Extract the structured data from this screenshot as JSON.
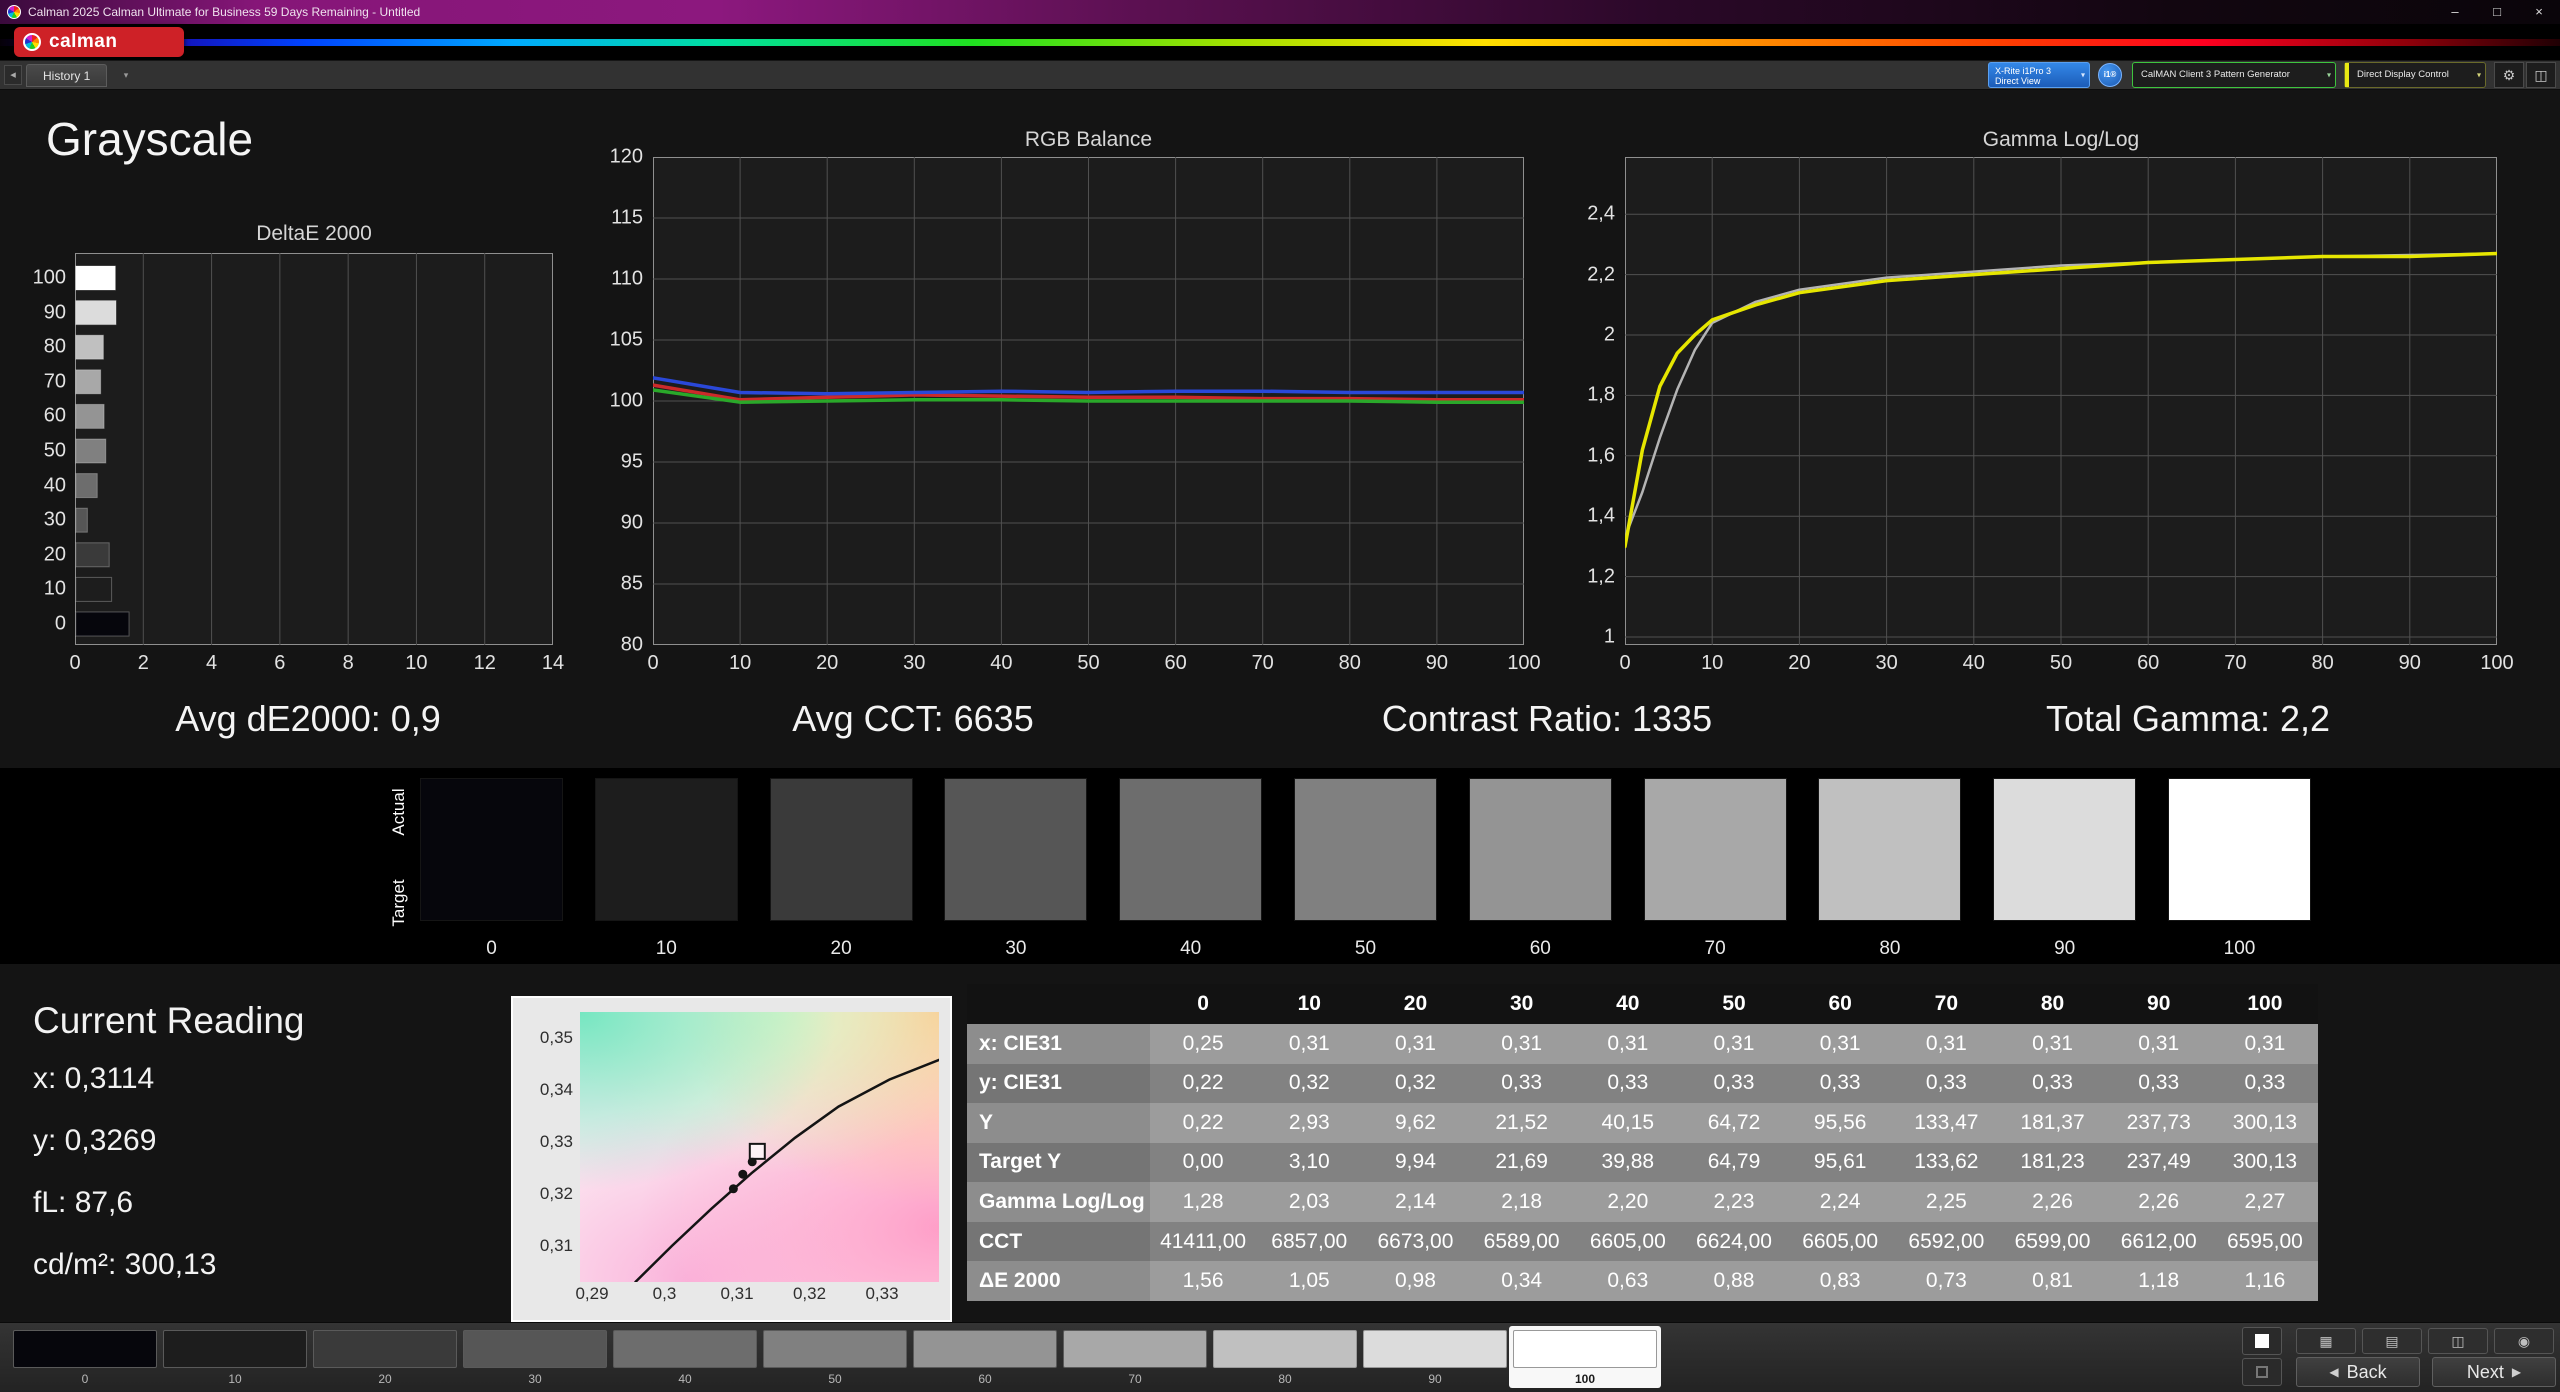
{
  "window": {
    "title": "Calman 2025 Calman Ultimate for Business 59 Days Remaining  - Untitled",
    "minimize": "–",
    "maximize": "□",
    "close": "×"
  },
  "logo": {
    "text": "calman"
  },
  "toolbar": {
    "history_tab": "History 1",
    "tab_scroll_icon": "◂",
    "tab_menu_icon": "▾",
    "chevron": "▾",
    "meter_line1": "X-Rite i1Pro 3",
    "meter_line2": "Direct View",
    "meter_badge": "i1®",
    "source": "CalMAN Client 3 Pattern Generator",
    "control": "Direct Display Control",
    "gear_icon": "⚙",
    "panel_icon": "◫"
  },
  "page": {
    "title": "Grayscale"
  },
  "charts": {
    "deltae": {
      "title": "DeltaE 2000",
      "y_ticks": [
        "100",
        "90",
        "80",
        "70",
        "60",
        "50",
        "40",
        "30",
        "20",
        "10",
        "0"
      ],
      "x_ticks": [
        "0",
        "2",
        "4",
        "6",
        "8",
        "10",
        "12",
        "14"
      ],
      "x_max": 14,
      "bars": [
        {
          "level": "100",
          "value": 1.16
        },
        {
          "level": "90",
          "value": 1.18
        },
        {
          "level": "80",
          "value": 0.81
        },
        {
          "level": "70",
          "value": 0.73
        },
        {
          "level": "60",
          "value": 0.83
        },
        {
          "level": "50",
          "value": 0.88
        },
        {
          "level": "40",
          "value": 0.63
        },
        {
          "level": "30",
          "value": 0.34
        },
        {
          "level": "20",
          "value": 0.98
        },
        {
          "level": "10",
          "value": 1.05
        },
        {
          "level": "0",
          "value": 1.56
        }
      ]
    },
    "rgb": {
      "title": "RGB Balance",
      "y_ticks": [
        "120",
        "115",
        "110",
        "105",
        "100",
        "95",
        "90",
        "85",
        "80"
      ],
      "x_ticks": [
        "0",
        "10",
        "20",
        "30",
        "40",
        "50",
        "60",
        "70",
        "80",
        "90",
        "100"
      ],
      "series": [
        {
          "name": "red",
          "color": "#cc2a2a",
          "values": [
            101.3,
            100.1,
            100.3,
            100.5,
            100.4,
            100.3,
            100.3,
            100.2,
            100.2,
            100.1,
            100.1
          ]
        },
        {
          "name": "green",
          "color": "#2aa82a",
          "values": [
            100.9,
            99.9,
            100.0,
            100.1,
            100.1,
            100.0,
            100.0,
            100.0,
            100.0,
            99.9,
            99.9
          ]
        },
        {
          "name": "blue",
          "color": "#2a48d8",
          "values": [
            101.9,
            100.7,
            100.6,
            100.7,
            100.8,
            100.7,
            100.8,
            100.8,
            100.7,
            100.7,
            100.7
          ]
        }
      ]
    },
    "gamma": {
      "title": "Gamma Log/Log",
      "y_ticks": [
        "2,4",
        "2,2",
        "2",
        "1,8",
        "1,6",
        "1,4",
        "1,2",
        "1"
      ],
      "x_ticks": [
        "0",
        "10",
        "20",
        "30",
        "40",
        "50",
        "60",
        "70",
        "80",
        "90",
        "100"
      ],
      "series": [
        {
          "name": "target",
          "color": "#b4b4b4",
          "width": 2.5,
          "x": [
            0,
            2,
            4,
            6,
            8,
            10,
            15,
            20,
            30,
            40,
            50,
            60,
            70,
            80,
            90,
            100
          ],
          "y": [
            1.33,
            1.48,
            1.66,
            1.82,
            1.95,
            2.04,
            2.11,
            2.15,
            2.19,
            2.21,
            2.23,
            2.24,
            2.25,
            2.26,
            2.265,
            2.27
          ]
        },
        {
          "name": "measured",
          "color": "#e6e600",
          "width": 3.5,
          "x": [
            0,
            2,
            4,
            6,
            8,
            10,
            15,
            20,
            30,
            40,
            50,
            60,
            70,
            80,
            90,
            100
          ],
          "y": [
            1.3,
            1.62,
            1.83,
            1.94,
            2.0,
            2.05,
            2.1,
            2.14,
            2.18,
            2.2,
            2.22,
            2.24,
            2.25,
            2.26,
            2.26,
            2.27
          ]
        }
      ]
    }
  },
  "stats": [
    "Avg dE2000: 0,9",
    "Avg CCT: 6635",
    "Contrast Ratio: 1335",
    "Total Gamma: 2,2"
  ],
  "swatches": {
    "row_labels": [
      "Actual",
      "Target"
    ],
    "levels": [
      "0",
      "10",
      "20",
      "30",
      "40",
      "50",
      "60",
      "70",
      "80",
      "90",
      "100"
    ],
    "colors": [
      "#06060c",
      "#1d1d1d",
      "#3a3a3a",
      "#565656",
      "#6d6d6d",
      "#808080",
      "#949494",
      "#a8a8a8",
      "#c0c0c0",
      "#dcdcdc",
      "#ffffff"
    ]
  },
  "reading": {
    "title": "Current Reading",
    "lines": [
      "x: 0,3114",
      "y: 0,3269",
      "fL: 87,6",
      "cd/m²: 300,13"
    ]
  },
  "cie": {
    "y_ticks": [
      "0,35",
      "0,34",
      "0,33",
      "0,32",
      "0,31"
    ],
    "x_ticks": [
      "0,29",
      "0,3",
      "0,31",
      "0,32",
      "0,33"
    ],
    "curve": [
      [
        0.296,
        0.3031
      ],
      [
        0.301,
        0.31
      ],
      [
        0.3065,
        0.3172
      ],
      [
        0.312,
        0.324
      ],
      [
        0.318,
        0.3308
      ],
      [
        0.324,
        0.3368
      ],
      [
        0.331,
        0.342
      ],
      [
        0.3379,
        0.3458
      ]
    ],
    "points": [
      [
        0.3095,
        0.321
      ],
      [
        0.3108,
        0.3238
      ],
      [
        0.3121,
        0.3262
      ]
    ],
    "marker": [
      0.3128,
      0.3282
    ]
  },
  "table": {
    "columns": [
      "0",
      "10",
      "20",
      "30",
      "40",
      "50",
      "60",
      "70",
      "80",
      "90",
      "100"
    ],
    "rows": [
      {
        "label": "x: CIE31",
        "values": [
          "0,25",
          "0,31",
          "0,31",
          "0,31",
          "0,31",
          "0,31",
          "0,31",
          "0,31",
          "0,31",
          "0,31",
          "0,31"
        ]
      },
      {
        "label": "y: CIE31",
        "values": [
          "0,22",
          "0,32",
          "0,32",
          "0,33",
          "0,33",
          "0,33",
          "0,33",
          "0,33",
          "0,33",
          "0,33",
          "0,33"
        ]
      },
      {
        "label": "Y",
        "values": [
          "0,22",
          "2,93",
          "9,62",
          "21,52",
          "40,15",
          "64,72",
          "95,56",
          "133,47",
          "181,37",
          "237,73",
          "300,13"
        ]
      },
      {
        "label": "Target Y",
        "values": [
          "0,00",
          "3,10",
          "9,94",
          "21,69",
          "39,88",
          "64,79",
          "95,61",
          "133,62",
          "181,23",
          "237,49",
          "300,13"
        ]
      },
      {
        "label": "Gamma Log/Log",
        "values": [
          "1,28",
          "2,03",
          "2,14",
          "2,18",
          "2,20",
          "2,23",
          "2,24",
          "2,25",
          "2,26",
          "2,26",
          "2,27"
        ]
      },
      {
        "label": "CCT",
        "values": [
          "41411,00",
          "6857,00",
          "6673,00",
          "6589,00",
          "6605,00",
          "6624,00",
          "6605,00",
          "6592,00",
          "6599,00",
          "6612,00",
          "6595,00"
        ]
      },
      {
        "label": "ΔE 2000",
        "values": [
          "1,56",
          "1,05",
          "0,98",
          "0,34",
          "0,63",
          "0,88",
          "0,83",
          "0,73",
          "0,81",
          "1,18",
          "1,16"
        ]
      }
    ]
  },
  "bottom": {
    "levels": [
      "0",
      "10",
      "20",
      "30",
      "40",
      "50",
      "60",
      "70",
      "80",
      "90",
      "100"
    ],
    "selected_index": 10,
    "tools": [
      {
        "name": "grid-icon",
        "glyph": "▦"
      },
      {
        "name": "printer-icon",
        "glyph": "▤"
      },
      {
        "name": "save-icon",
        "glyph": "◫"
      },
      {
        "name": "camera-icon",
        "glyph": "◉"
      }
    ],
    "back_icon": "◀",
    "back": "Back",
    "next_icon": "▶",
    "next": "Next"
  }
}
